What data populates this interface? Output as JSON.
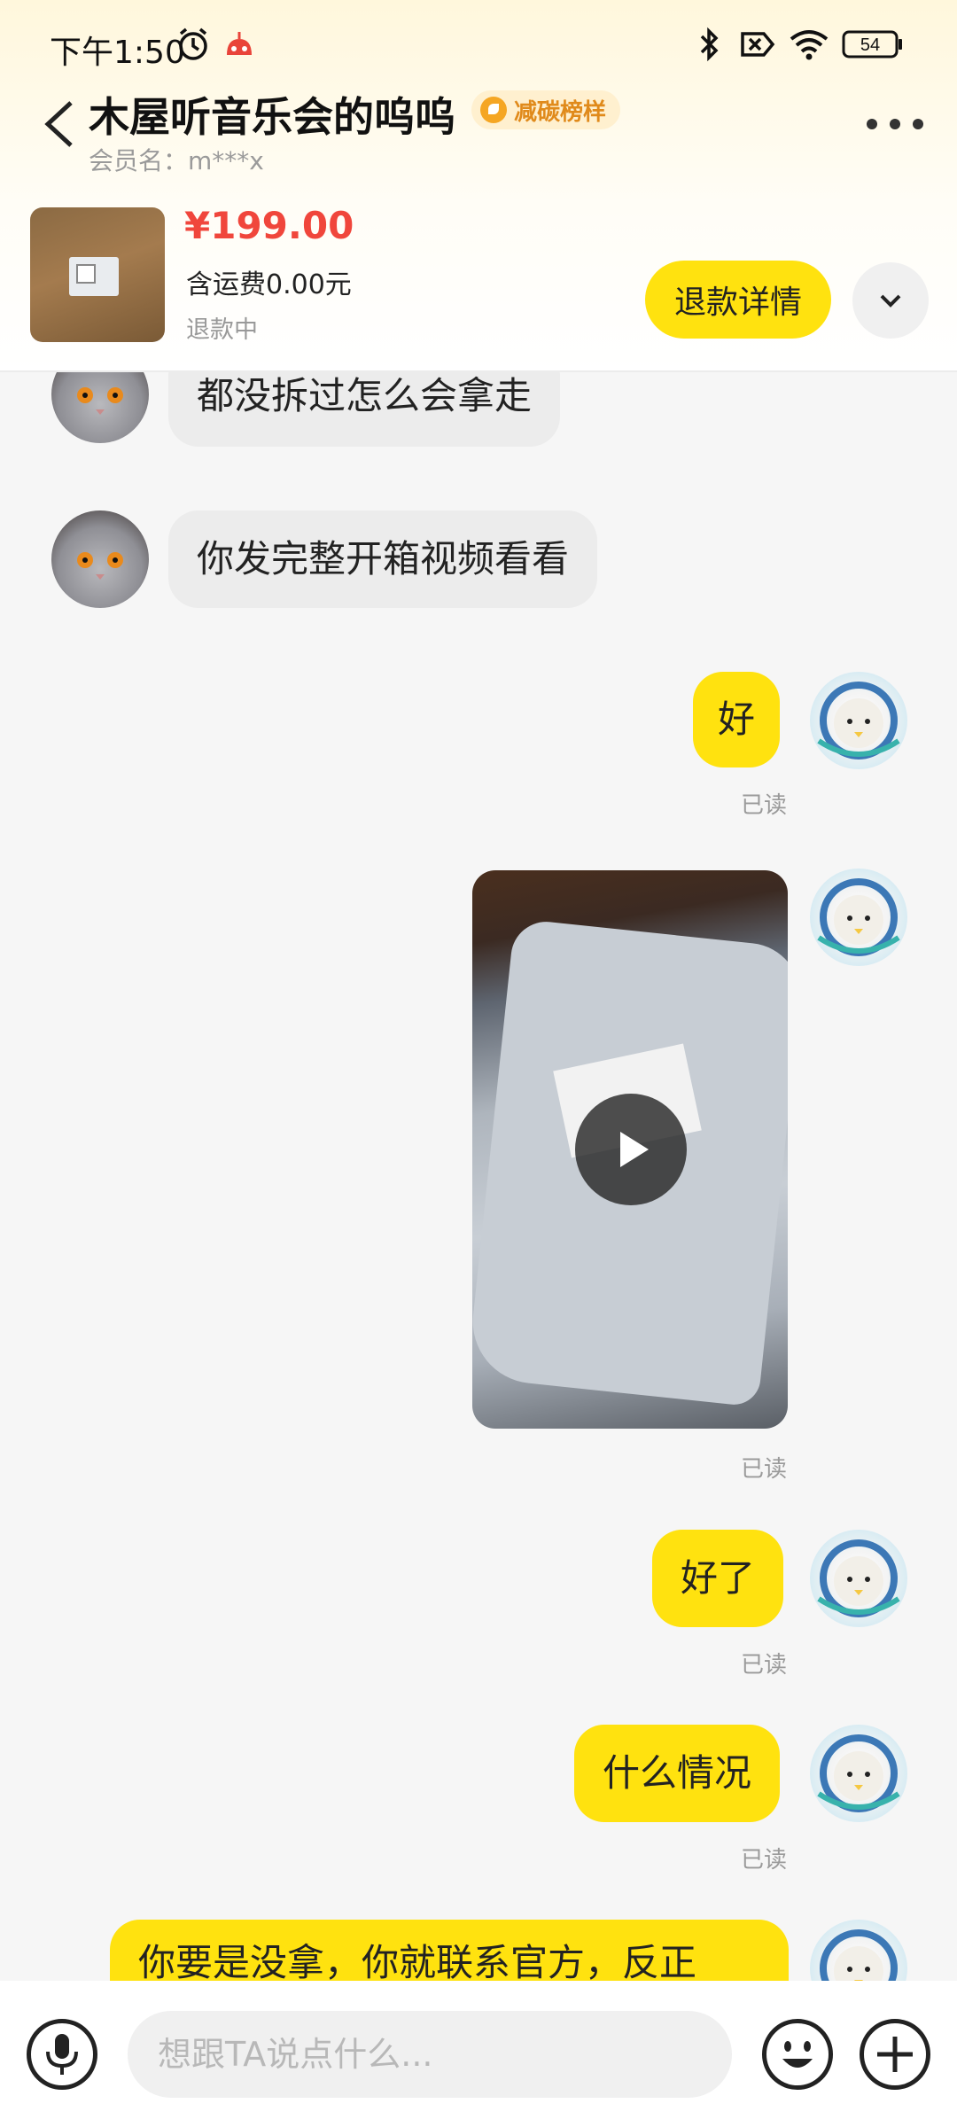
{
  "status_bar": {
    "time": "下午1:50",
    "battery": "54"
  },
  "header": {
    "title": "木屋听音乐会的呜呜",
    "badge": "减碳榜样",
    "member": "会员名：m***x"
  },
  "order": {
    "price": "¥199.00",
    "shipping": "含运费0.00元",
    "status": "退款中",
    "refund_button": "退款详情"
  },
  "messages": [
    {
      "side": "in",
      "text": "都没拆过怎么会拿走"
    },
    {
      "side": "in",
      "text": "你发完整开箱视频看看"
    },
    {
      "side": "out",
      "text": "好",
      "read": "已读"
    },
    {
      "side": "out",
      "type": "video",
      "read": "已读"
    },
    {
      "side": "out",
      "text": "好了",
      "read": "已读"
    },
    {
      "side": "out",
      "text": "什么情况",
      "read": "已读"
    },
    {
      "side": "out",
      "text": "你要是没拿，你就联系官方，反正"
    }
  ],
  "input": {
    "placeholder": "想跟TA说点什么..."
  },
  "colors": {
    "accent_yellow": "#ffe20f",
    "price_red": "#f0463c",
    "badge_orange": "#e08a1b"
  },
  "icons": [
    "back-arrow-icon",
    "more-icon",
    "chevron-down-icon",
    "microphone-icon",
    "emoji-icon",
    "plus-icon",
    "play-icon",
    "bluetooth-icon",
    "wifi-icon",
    "battery-icon",
    "alarm-icon"
  ]
}
